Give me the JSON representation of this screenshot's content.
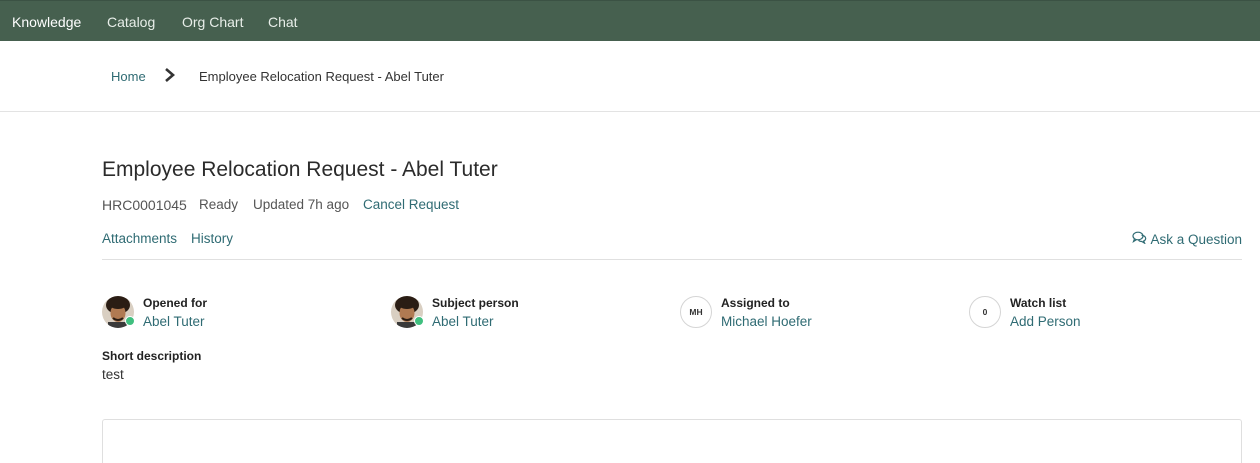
{
  "topnav": {
    "items": [
      {
        "label": "Knowledge",
        "active": true
      },
      {
        "label": "Catalog",
        "active": false
      },
      {
        "label": "Org Chart",
        "active": false
      },
      {
        "label": "Chat",
        "active": false
      }
    ],
    "background_color": "#46604f"
  },
  "breadcrumb": {
    "home": "Home",
    "separator_icon": "chevron-right-icon",
    "current": "Employee Relocation Request - Abel Tuter"
  },
  "request": {
    "title": "Employee Relocation Request - Abel Tuter",
    "number": "HRC0001045",
    "state": "Ready",
    "updated": "Updated 7h ago",
    "cancel_label": "Cancel Request"
  },
  "tabs": {
    "attachments": "Attachments",
    "history": "History",
    "ask_question": "Ask a Question",
    "ask_icon": "comments-icon"
  },
  "fields": {
    "opened_for": {
      "label": "Opened for",
      "value": "Abel Tuter"
    },
    "subject_person": {
      "label": "Subject person",
      "value": "Abel Tuter"
    },
    "assigned_to": {
      "label": "Assigned to",
      "value": "Michael Hoefer",
      "initials": "MH"
    },
    "watch_list": {
      "label": "Watch list",
      "value": "Add Person",
      "count": "0"
    }
  },
  "short_description": {
    "label": "Short description",
    "value": "test"
  },
  "colors": {
    "link": "#2f6b73",
    "presence_online": "#3fbf7f"
  }
}
